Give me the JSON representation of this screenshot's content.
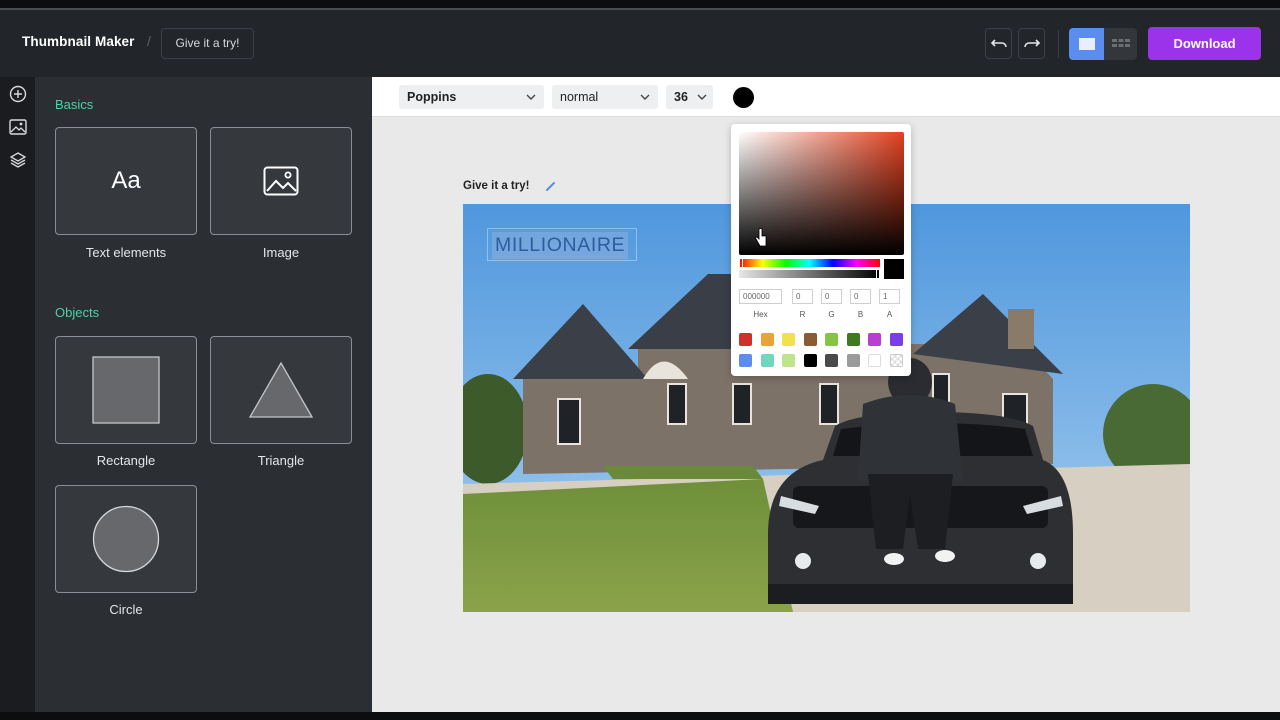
{
  "header": {
    "app_title": "Thumbnail Maker",
    "separator": "/",
    "project_name": "Give it a try!",
    "download_label": "Download"
  },
  "sidebar": {
    "rail_icons": [
      "add-icon",
      "image-icon",
      "layers-icon"
    ],
    "basics_title": "Basics",
    "objects_title": "Objects",
    "text_tile_glyph": "Aa",
    "items": {
      "text": "Text elements",
      "image": "Image",
      "rectangle": "Rectangle",
      "triangle": "Triangle",
      "circle": "Circle"
    }
  },
  "toolbar": {
    "font_family": "Poppins",
    "font_weight": "normal",
    "font_size": "36",
    "text_color": "#000000"
  },
  "canvas": {
    "title": "Give it a try!",
    "text_element": "MILLIONAIRE"
  },
  "color_picker": {
    "hex_value": "000000",
    "r": "0",
    "g": "0",
    "b": "0",
    "a": "1",
    "labels": {
      "hex": "Hex",
      "r": "R",
      "g": "G",
      "b": "B",
      "a": "A"
    },
    "hue_color": "#e2401f",
    "swatches": [
      "#d0302a",
      "#e8a33a",
      "#f1e14a",
      "#8a5b34",
      "#86c446",
      "#3f7a23",
      "#b93fd3",
      "#7a3fe6",
      "#5b8def",
      "#6fd6c0",
      "#bfe58c",
      "#000000",
      "#4a4a4a",
      "#9b9b9b",
      "#ffffff",
      "transparent"
    ]
  },
  "colors": {
    "accent_purple": "#9a33ea",
    "accent_blue": "#5b8def",
    "section_green": "#4fd1a5"
  }
}
